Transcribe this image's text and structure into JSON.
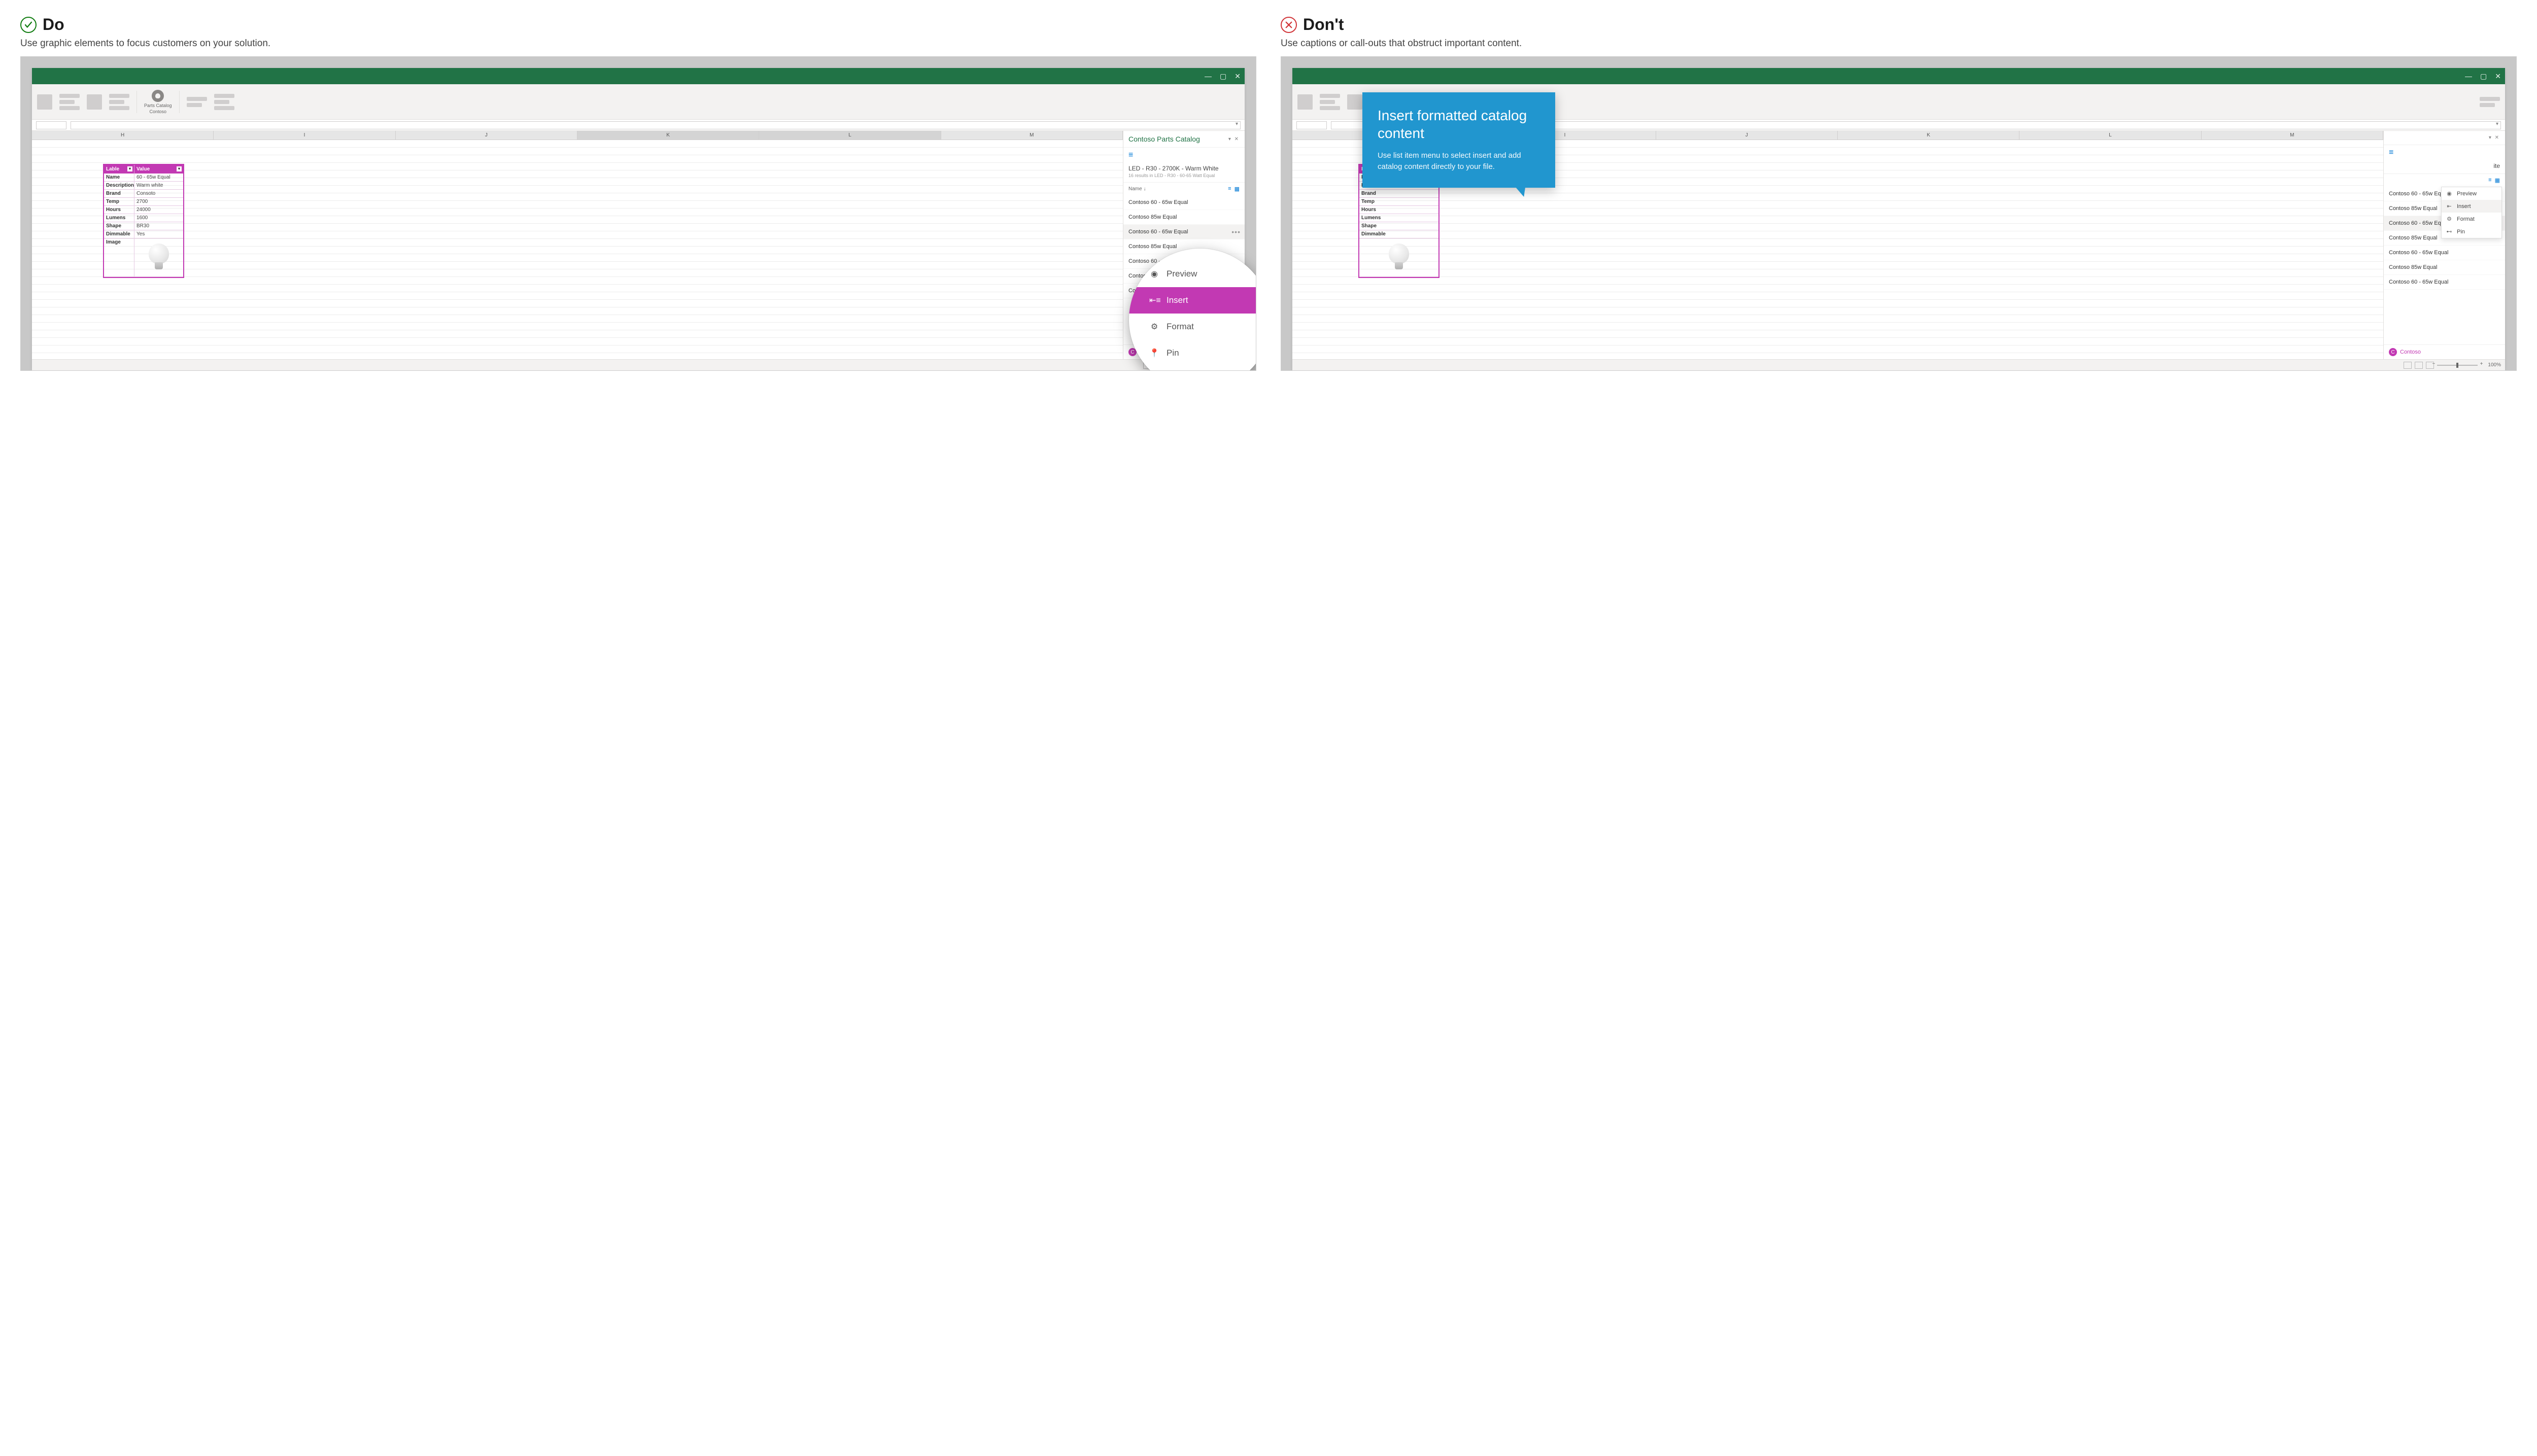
{
  "do": {
    "title": "Do",
    "subtitle": "Use graphic elements to focus customers on your solution."
  },
  "dont": {
    "title": "Don't",
    "subtitle": "Use captions or call-outs that obstruct important content."
  },
  "ribbon": {
    "addin_label1": "Parts Catalog",
    "addin_label2": "Contoso"
  },
  "columns": [
    "H",
    "I",
    "J",
    "K",
    "L",
    "M"
  ],
  "table": {
    "hdr1": "Lable",
    "hdr2": "Value",
    "rows": [
      {
        "k": "Name",
        "v": "60 - 65w Equal"
      },
      {
        "k": "Description",
        "v": "Warm white"
      },
      {
        "k": "Brand",
        "v": "Consoto"
      },
      {
        "k": "Temp",
        "v": "2700"
      },
      {
        "k": "Hours",
        "v": "24000"
      },
      {
        "k": "Lumens",
        "v": "1600"
      },
      {
        "k": "Shape",
        "v": "BR30"
      },
      {
        "k": "Dimmable",
        "v": "Yes"
      },
      {
        "k": "Image",
        "v": ""
      }
    ]
  },
  "pane": {
    "title": "Contoso Parts Catalog",
    "product": "LED - R30 - 2700K - Warm White",
    "sub": "16 results in LED - R30 - 60-65 Watt Equal",
    "name_label": "Name",
    "items": [
      "Contoso 60 - 65w Equal",
      "Contoso 85w Equal",
      "Contoso 60 - 65w Equal",
      "Contoso 85w Equal",
      "Contoso 60 - 65w Equal",
      "Contoso 85w Equal",
      "Contoso 60 - 65w Equal"
    ],
    "footer": "Contoso",
    "footer_initial": "C"
  },
  "mag": {
    "preview": "Preview",
    "insert": "Insert",
    "format": "Format",
    "pin": "Pin"
  },
  "ctx": {
    "preview": "Preview",
    "insert": "Insert",
    "format": "Format",
    "pin": "Pin"
  },
  "callout": {
    "heading": "Insert formatted catalog content",
    "body": "Use list item menu to select insert and add catalog content directly to your file."
  },
  "status": {
    "zoom": "100%"
  }
}
